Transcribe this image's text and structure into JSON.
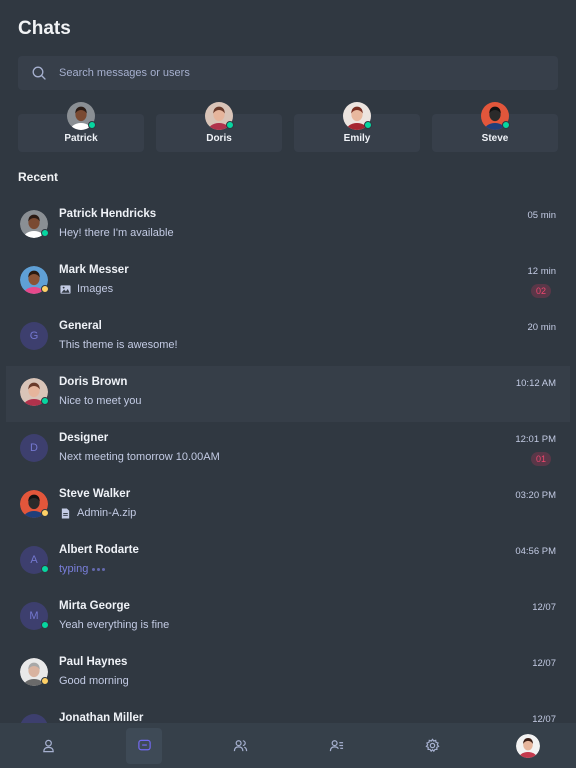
{
  "header": {
    "title": "Chats"
  },
  "search": {
    "placeholder": "Search messages or users"
  },
  "online_users": [
    {
      "name": "Patrick",
      "avatar": "patrick-photo",
      "status": "online"
    },
    {
      "name": "Doris",
      "avatar": "doris-photo",
      "status": "online"
    },
    {
      "name": "Emily",
      "avatar": "emily-photo",
      "status": "online"
    },
    {
      "name": "Steve",
      "avatar": "steve-photo",
      "status": "online"
    }
  ],
  "recent": {
    "heading": "Recent",
    "chats": [
      {
        "name": "Patrick Hendricks",
        "message": "Hey! there I'm available",
        "time": "05 min",
        "avatar": "patrick-photo",
        "status": "online"
      },
      {
        "name": "Mark Messer",
        "message": "Images",
        "message_icon": "image-icon",
        "time": "12 min",
        "badge": "02",
        "avatar": "mark-photo",
        "status": "away"
      },
      {
        "name": "General",
        "message": "This theme is awesome!",
        "time": "20 min",
        "letter": "G"
      },
      {
        "name": "Doris Brown",
        "message": "Nice to meet you",
        "time": "10:12 AM",
        "avatar": "doris-photo",
        "status": "online",
        "active": true
      },
      {
        "name": "Designer",
        "message": "Next meeting tomorrow 10.00AM",
        "time": "12:01 PM",
        "badge": "01",
        "letter": "D"
      },
      {
        "name": "Steve Walker",
        "message": "Admin-A.zip",
        "message_icon": "file-icon",
        "time": "03:20 PM",
        "avatar": "steve-photo",
        "status": "away"
      },
      {
        "name": "Albert Rodarte",
        "message": "typing",
        "typing": true,
        "time": "04:56 PM",
        "letter": "A",
        "status": "online"
      },
      {
        "name": "Mirta George",
        "message": "Yeah everything is fine",
        "time": "12/07",
        "letter": "M",
        "status": "online"
      },
      {
        "name": "Paul Haynes",
        "message": "Good morning",
        "time": "12/07",
        "avatar": "paul-photo",
        "status": "away"
      },
      {
        "name": "Jonathan Miller",
        "message": "",
        "time": "12/07",
        "letter": "J"
      }
    ]
  },
  "nav": [
    {
      "icon": "profile-icon",
      "active": false
    },
    {
      "icon": "chat-icon",
      "active": true
    },
    {
      "icon": "groups-icon",
      "active": false
    },
    {
      "icon": "contacts-icon",
      "active": false
    },
    {
      "icon": "settings-icon",
      "active": false
    },
    {
      "icon": "user-avatar",
      "active": false
    }
  ],
  "colors": {
    "background": "#303841",
    "online": "#06d6a0",
    "away": "#ffd166",
    "accent": "#7269ef",
    "badge": "#ef476f"
  }
}
